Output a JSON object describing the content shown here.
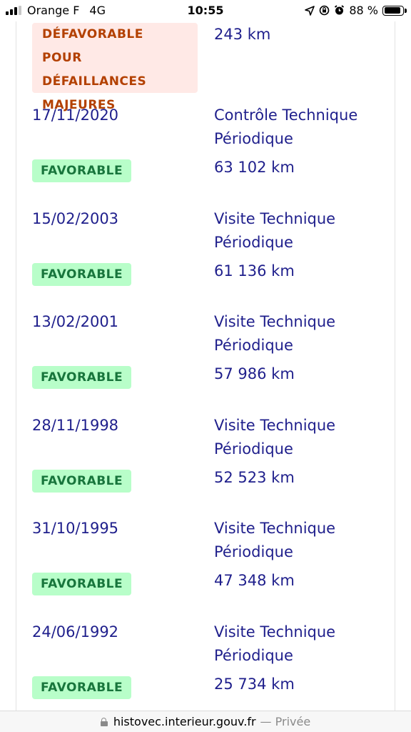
{
  "status_bar": {
    "carrier": "Orange F",
    "network": "4G",
    "time": "10:55",
    "battery": "88 %",
    "battery_level": 0.88
  },
  "history": {
    "first_result": "DÉFAVORABLE POUR DÉFAILLANCES MAJEURES",
    "first_km": "243 km",
    "entries": [
      {
        "date": "17/11/2020",
        "type": "Contrôle Technique Périodique",
        "result": "FAVORABLE",
        "km": "63 102 km"
      },
      {
        "date": "15/02/2003",
        "type": "Visite Technique Périodique",
        "result": "FAVORABLE",
        "km": "61 136 km"
      },
      {
        "date": "13/02/2001",
        "type": "Visite Technique Périodique",
        "result": "FAVORABLE",
        "km": "57 986 km"
      },
      {
        "date": "28/11/1998",
        "type": "Visite Technique Périodique",
        "result": "FAVORABLE",
        "km": "52 523 km"
      },
      {
        "date": "31/10/1995",
        "type": "Visite Technique Périodique",
        "result": "FAVORABLE",
        "km": "47 348 km"
      },
      {
        "date": "24/06/1992",
        "type": "Visite Technique Périodique",
        "result": "FAVORABLE",
        "km": "25 734 km"
      }
    ]
  },
  "url_bar": {
    "domain": "histovec.interieur.gouv.fr",
    "suffix": "— Privée"
  },
  "colors": {
    "text_blue": "#1f1f8c",
    "ok_bg": "#b8fec9",
    "ok_text": "#18753c",
    "bad_bg": "#ffe9e6",
    "bad_text": "#b34000"
  }
}
